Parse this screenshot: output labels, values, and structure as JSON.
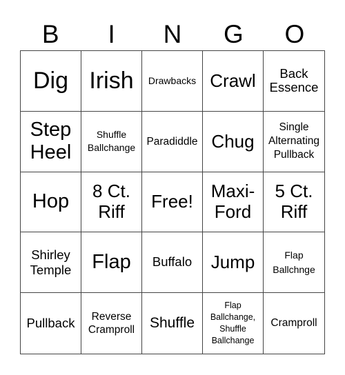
{
  "header": [
    "B",
    "I",
    "N",
    "G",
    "O"
  ],
  "cells": [
    "Dig",
    "Irish",
    "Drawbacks",
    "Crawl",
    "Back\nEssence",
    "Step\nHeel",
    "Shuffle\nBallchange",
    "Paradiddle",
    "Chug",
    "Single\nAlternating\nPullback",
    "Hop",
    "8 Ct.\nRiff",
    "Free!",
    "Maxi-\nFord",
    "5 Ct.\nRiff",
    "Shirley\nTemple",
    "Flap",
    "Buffalo",
    "Jump",
    "Flap\nBallchnge",
    "Pullback",
    "Reverse\nCramproll",
    "Shuffle",
    "Flap\nBallchange,\nShuffle\nBallchange",
    "Cramproll"
  ]
}
